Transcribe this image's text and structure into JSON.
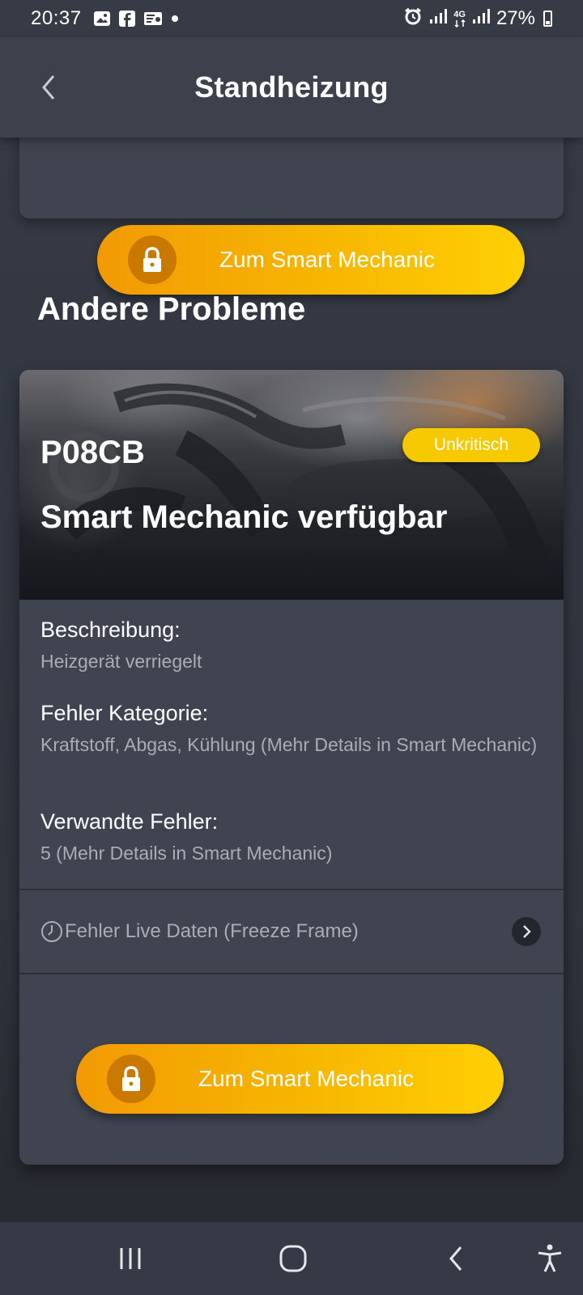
{
  "status_bar": {
    "time": "20:37",
    "battery": "27%",
    "network": "4G",
    "notification_icons": [
      "image-icon",
      "facebook-icon",
      "message-icon",
      "dot-icon"
    ],
    "system_icons": [
      "alarm-icon",
      "signal-icon",
      "signal-4g-icon",
      "signal-icon",
      "battery-icon"
    ]
  },
  "header": {
    "title": "Standheizung"
  },
  "top_card": {
    "cta_label": "Zum Smart Mechanic"
  },
  "section": {
    "title": "Andere Probleme"
  },
  "problem_card": {
    "code": "P08CB",
    "severity": "Unkritisch",
    "title": "Smart Mechanic verfügbar",
    "description_label": "Beschreibung:",
    "description_value": "Heizgerät verriegelt",
    "category_label": "Fehler Kategorie:",
    "category_value": "Kraftstoff, Abgas, Kühlung  (Mehr Details in Smart Mechanic)",
    "related_label": "Verwandte Fehler:",
    "related_value": "5  (Mehr Details in Smart Mechanic)",
    "freeze_frame_label": "Fehler Live Daten (Freeze Frame)",
    "cta_label": "Zum Smart Mechanic"
  },
  "colors": {
    "accent_orange": "#f29a05",
    "accent_yellow": "#ffcf05",
    "badge_yellow": "#f7c900",
    "background": "#363b46",
    "card": "#3f4450",
    "muted_text": "#a9adb6"
  },
  "nav": {
    "buttons": [
      "recent-apps",
      "home",
      "back",
      "accessibility"
    ]
  }
}
